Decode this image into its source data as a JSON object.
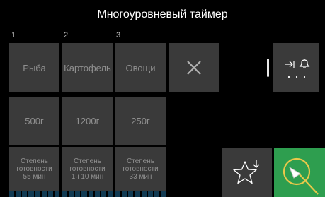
{
  "header": {
    "title": "Многоуровневый таймер"
  },
  "columns": [
    {
      "number": "1",
      "food": "Рыба",
      "weight": "500г",
      "cook_line1": "Степень",
      "cook_line2": "готовности",
      "cook_line3": "55 мин"
    },
    {
      "number": "2",
      "food": "Картофель",
      "weight": "1200г",
      "cook_line1": "Степень",
      "cook_line2": "готовности",
      "cook_line3": "1ч 10 мин"
    },
    {
      "number": "3",
      "food": "Овощи",
      "weight": "250г",
      "cook_line1": "Степень",
      "cook_line2": "готовности",
      "cook_line3": "33 мин"
    }
  ],
  "icons": {
    "cancel": "close-icon",
    "menu": [
      "skip-to-end-icon",
      "bell-icon",
      "more-dots-icon"
    ],
    "favorite": "star-add-icon",
    "start": "start-touch-icon"
  },
  "colors": {
    "background": "#000000",
    "tile": "#3a3a3a",
    "tile_text": "#8f8f8f",
    "start": "#2e9e4f",
    "progress": "#123b53"
  }
}
